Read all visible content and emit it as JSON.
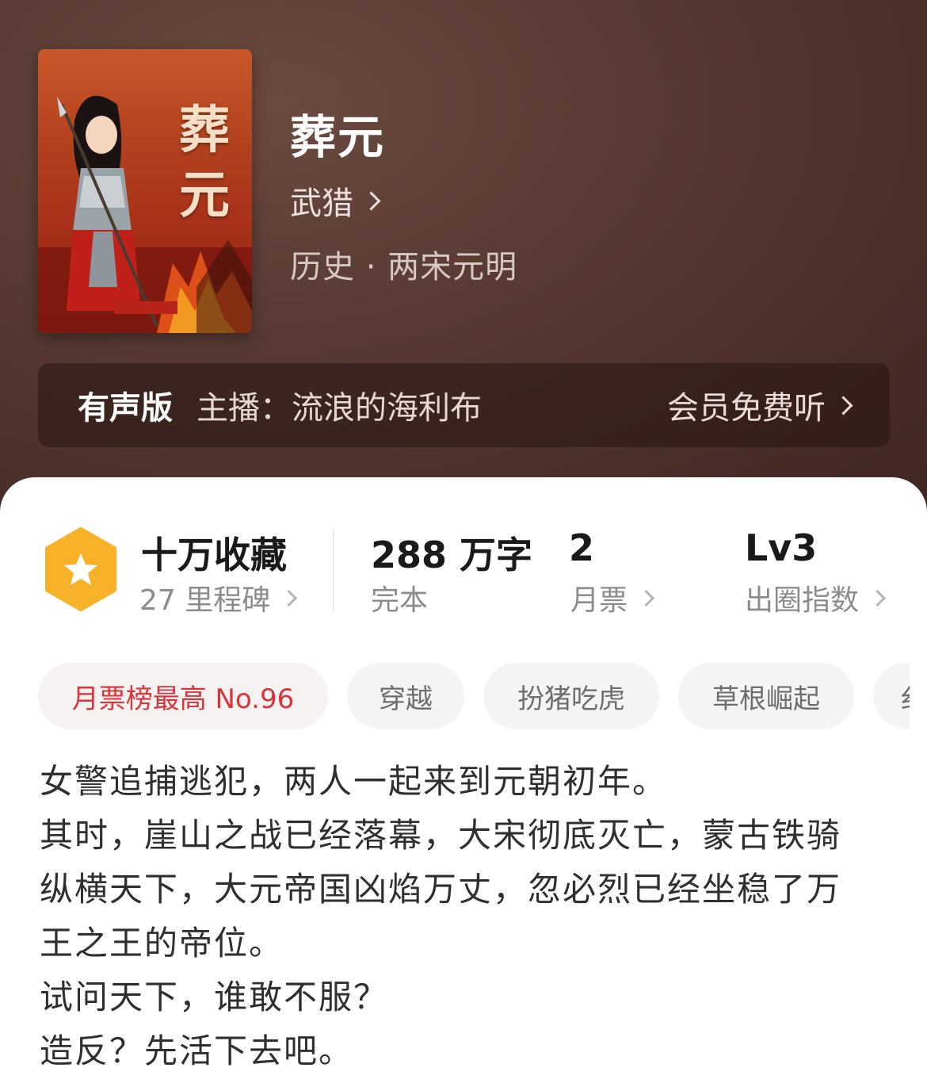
{
  "book": {
    "cover_title": "葬元",
    "title": "葬元",
    "author": "武猎",
    "genre": "历史 · 两宋元明"
  },
  "audio": {
    "label": "有声版",
    "host": "主播：流浪的海利布",
    "vip_text": "会员免费听"
  },
  "stats": {
    "collect_main": "十万收藏",
    "collect_sub": "27 里程碑",
    "words_main": "288 万字",
    "words_sub": "完本",
    "ticket_main": "2",
    "ticket_sub": "月票",
    "level_main": "Lv3",
    "level_sub": "出圈指数"
  },
  "tags": [
    "月票榜最高 No.96",
    "穿越",
    "扮猪吃虎",
    "草根崛起",
    "纟"
  ],
  "description": [
    "女警追捕逃犯，两人一起来到元朝初年。",
    "其时，崖山之战已经落幕，大宋彻底灭亡，蒙古铁骑",
    "纵横天下，大元帝国凶焰万丈，忽必烈已经坐稳了万",
    "王之王的帝位。",
    "试问天下，谁敢不服？",
    "造反？先活下去吧。"
  ],
  "colors": {
    "hero_bg": "#4b2f29",
    "rank_tag": "#d9343c",
    "badge": "#f7b22a"
  }
}
